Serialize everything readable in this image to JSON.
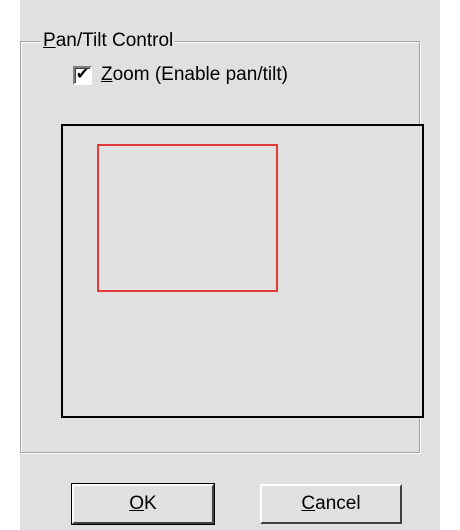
{
  "dialog": {
    "group_title_prefix": "",
    "group_title_accel": "P",
    "group_title_rest": "an/Tilt Control",
    "zoom_checkbox": {
      "checked": true,
      "check_mark": "✔",
      "label_accel": "Z",
      "label_rest": "oom (Enable pan/tilt)"
    },
    "zoom_rect_color": "#e33b3b",
    "buttons": {
      "ok_accel": "O",
      "ok_rest": "K",
      "cancel_accel": "C",
      "cancel_rest": "ancel"
    }
  }
}
